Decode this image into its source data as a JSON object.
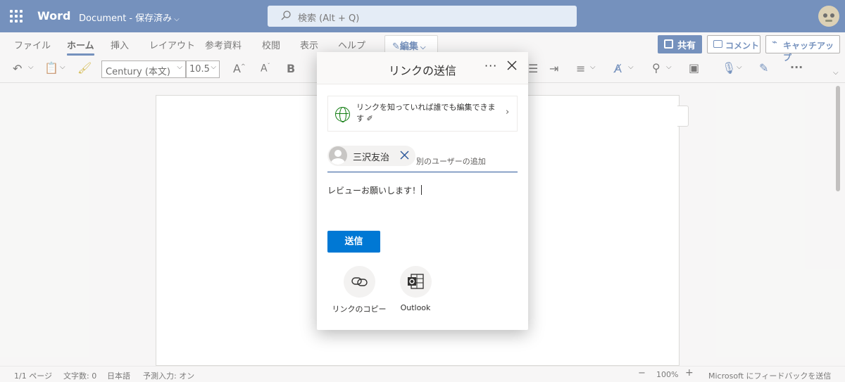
{
  "titlebar": {
    "app_name": "Word",
    "doc_name": "Document",
    "separator": "-",
    "save_status": "保存済み",
    "search_placeholder": "検索 (Alt + Q)"
  },
  "ribbon": {
    "tabs": [
      "ファイル",
      "ホーム",
      "挿入",
      "レイアウト",
      "参考資料",
      "校閲",
      "表示",
      "ヘルプ"
    ],
    "active_tab": "ホーム",
    "edit_mode": "編集",
    "share": "共有",
    "comment": "コメント",
    "catchup": "キャッチアップ",
    "font_name": "Century (本文)",
    "font_size": "10.5"
  },
  "dialog": {
    "title": "リンクの送信",
    "more": "···",
    "link_setting": "リンクを知っていれば誰でも編集できます",
    "recipient": "三沢友治",
    "add_user_placeholder": "別のユーザーの追加",
    "message": "レビューお願いします！",
    "send": "送信",
    "copy_link": "リンクのコピー",
    "outlook": "Outlook"
  },
  "statusbar": {
    "page": "1/1 ページ",
    "word_count": "文字数: 0",
    "language": "日本語",
    "predictive": "予測入力: オン",
    "zoom_minus": "−",
    "zoom": "100%",
    "zoom_plus": "+",
    "feedback": "Microsoft にフィードバックを送信"
  },
  "colors": {
    "brand": "#2b579a",
    "send_button": "#0078d4"
  }
}
